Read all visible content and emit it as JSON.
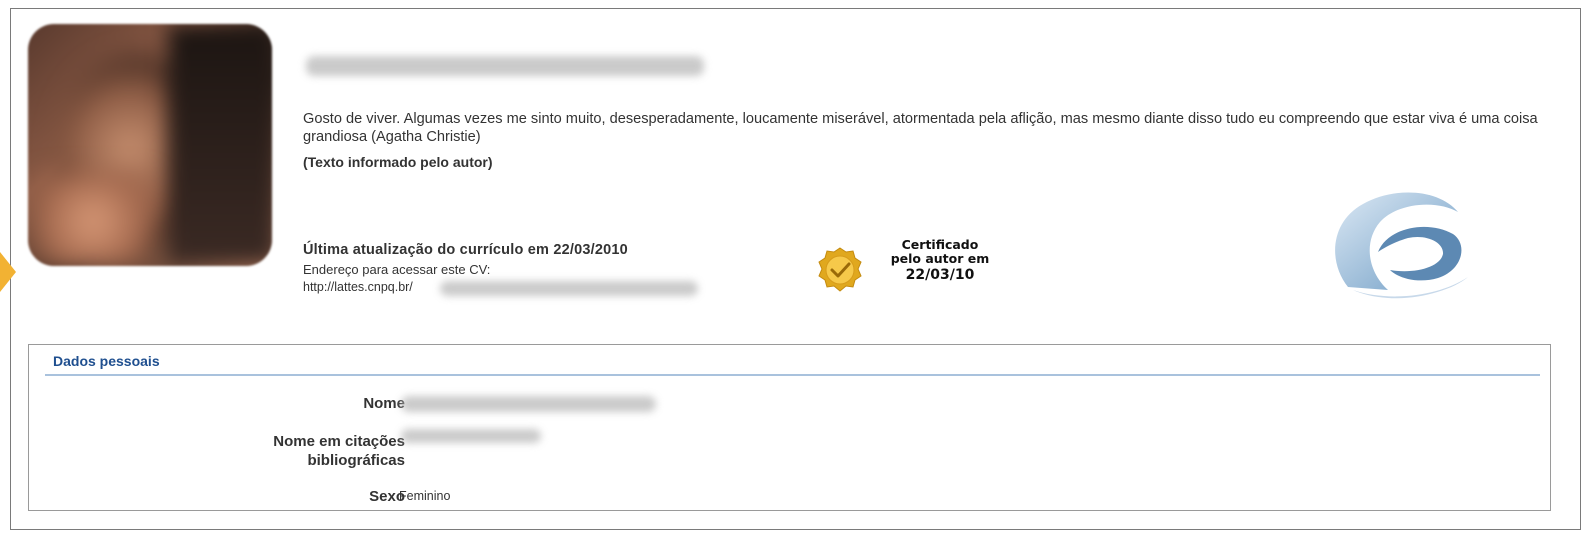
{
  "profile": {
    "quote": "Gosto de viver. Algumas vezes me sinto muito, desesperadamente, loucamente miserável, atormentada pela aflição, mas mesmo diante disso tudo eu compreendo que estar viva é uma coisa grandiosa (Agatha Christie)",
    "author_note": "(Texto informado pelo autor)",
    "last_update": "Última atualização do currículo em 22/03/2010",
    "address_label": "Endereço para acessar este CV:",
    "url_prefix": "http://lattes.cnpq.br/"
  },
  "certification": {
    "line1": "Certificado",
    "line2": "pelo autor em",
    "date": "22/03/10",
    "seal_color": "#f2b233"
  },
  "personal_data": {
    "title": "Dados pessoais",
    "rows": [
      {
        "label": "Nome",
        "value": ""
      },
      {
        "label_line1": "Nome em citações",
        "label_line2": "bibliográficas",
        "value": ""
      },
      {
        "label": "Sexo",
        "value": "Feminino"
      }
    ]
  },
  "colors": {
    "panel_title": "#1f4f8f",
    "accent_arrow": "#f2b233",
    "logo_blue": "#6e9cc4"
  },
  "icons": {
    "seal": "certified-seal-icon",
    "logo": "lattes-logo-icon"
  }
}
